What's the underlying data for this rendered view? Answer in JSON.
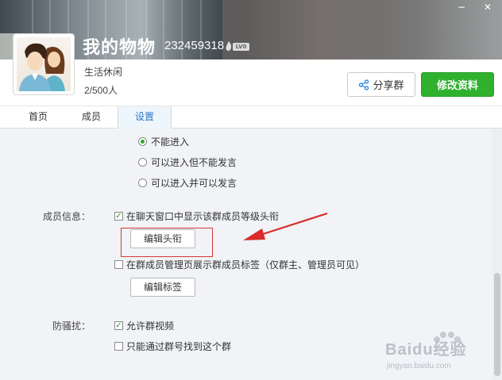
{
  "window": {
    "minimize_label": "−",
    "close_label": "✕"
  },
  "header": {
    "group_name": "我的物物",
    "group_id": "232459318",
    "level_badge": "LV0",
    "category": "生活休闲",
    "member_count": "2/500人",
    "share_label": "分享群",
    "edit_label": "修改资料"
  },
  "tabs": [
    {
      "label": "首页"
    },
    {
      "label": "成员"
    },
    {
      "label": "设置"
    }
  ],
  "settings": {
    "join_options": [
      {
        "label": "不能进入",
        "checked": true
      },
      {
        "label": "可以进入但不能发言",
        "checked": false
      },
      {
        "label": "可以进入并可以发言",
        "checked": false
      }
    ],
    "member_info_label": "成员信息：",
    "show_title_checkbox": {
      "label": "在聊天窗口中显示该群成员等级头衔",
      "checked": true
    },
    "edit_title_button": "编辑头衔",
    "show_tag_checkbox": {
      "label": "在群成员管理页展示群成员标签（仅群主、管理员可见）",
      "checked": false
    },
    "edit_tag_button": "编辑标签",
    "anti_harass_label": "防骚扰：",
    "allow_video_checkbox": {
      "label": "允许群视频",
      "checked": true
    },
    "find_by_number_checkbox": {
      "label": "只能通过群号找到这个群",
      "checked": false
    }
  },
  "watermark": {
    "text": "Baidu经验",
    "sub": "jingyan.baidu.com"
  },
  "colors": {
    "accent_green": "#2fb12f",
    "tab_active": "#2b7ac9",
    "annotation_red": "#d92b2b"
  }
}
